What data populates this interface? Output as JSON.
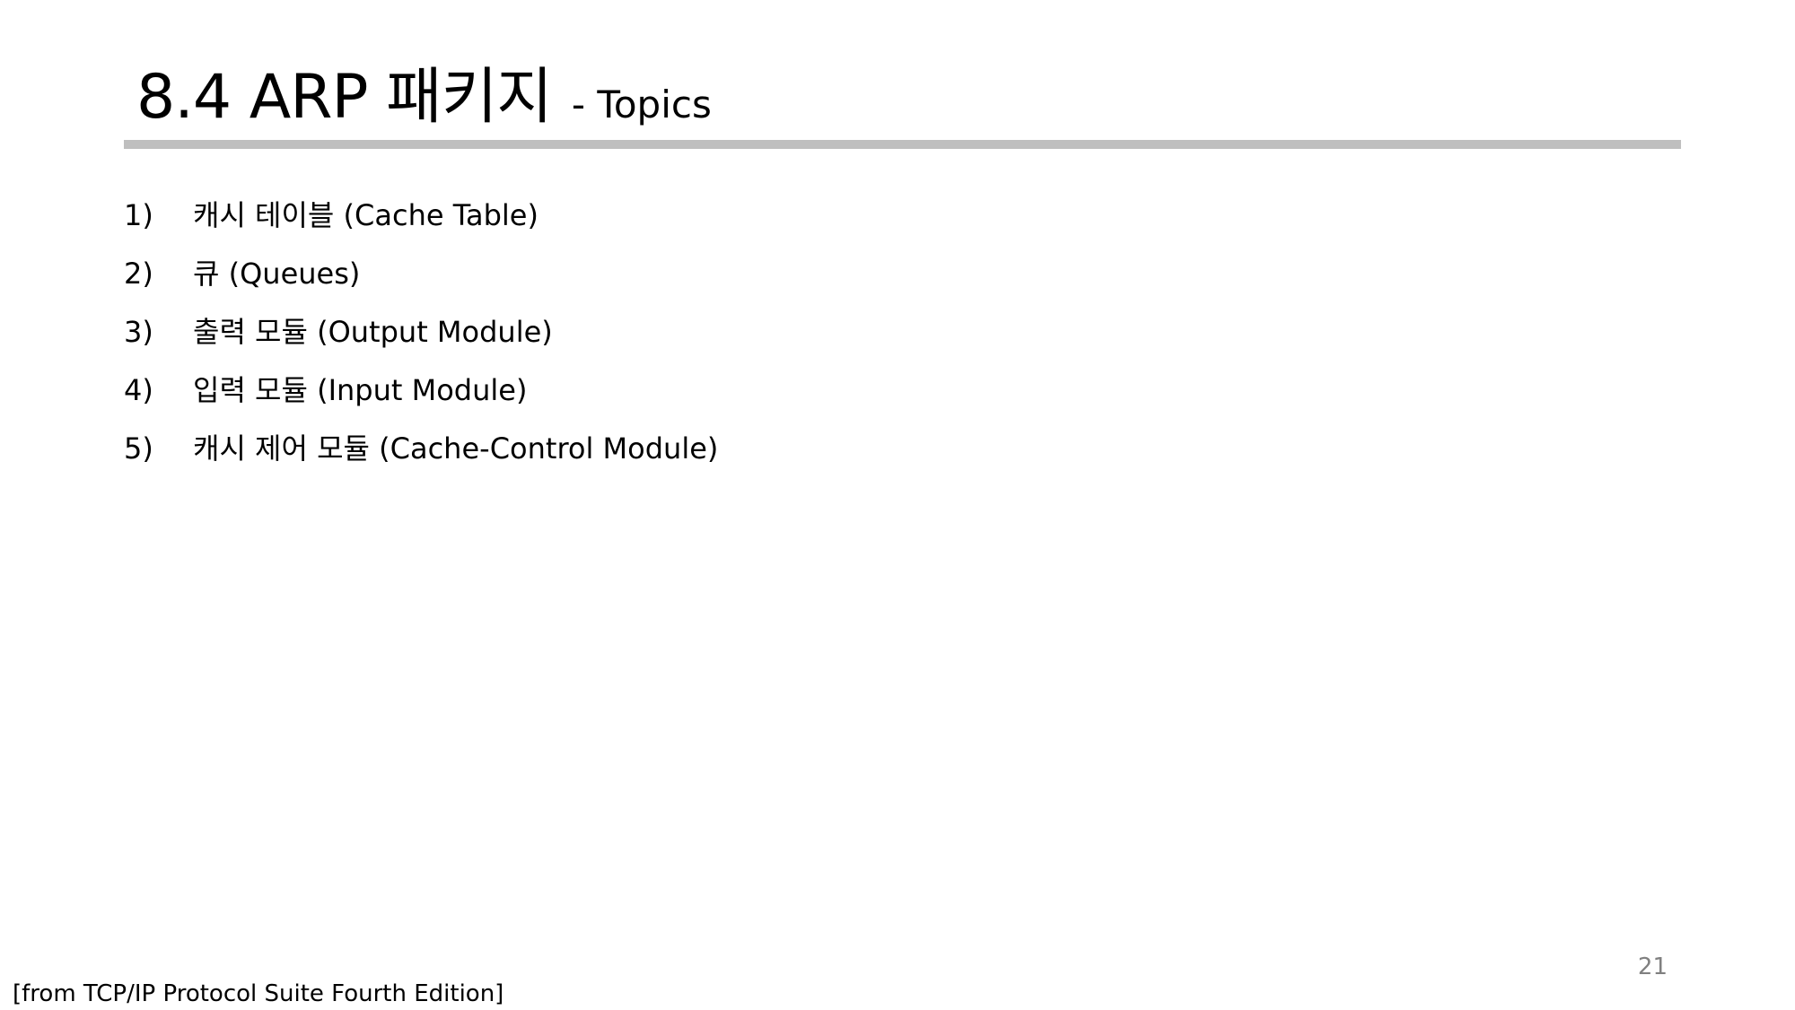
{
  "slide": {
    "title_main": "8.4 ARP 패키지",
    "title_sub": "- Topics",
    "topics": [
      {
        "number": "1)",
        "text": "캐시 테이블 (Cache Table)"
      },
      {
        "number": "2)",
        "text": "큐 (Queues)"
      },
      {
        "number": "3)",
        "text": "출력 모듈 (Output Module)"
      },
      {
        "number": "4)",
        "text": "입력 모듈 (Input Module)"
      },
      {
        "number": "5)",
        "text": "캐시 제어 모듈 (Cache-Control Module)"
      }
    ],
    "page_number": "21",
    "source_note": "[from TCP/IP Protocol Suite Fourth Edition]"
  },
  "colors": {
    "rule": "#bfbfbf",
    "page_number": "#808080",
    "text": "#000000",
    "background": "#ffffff"
  }
}
